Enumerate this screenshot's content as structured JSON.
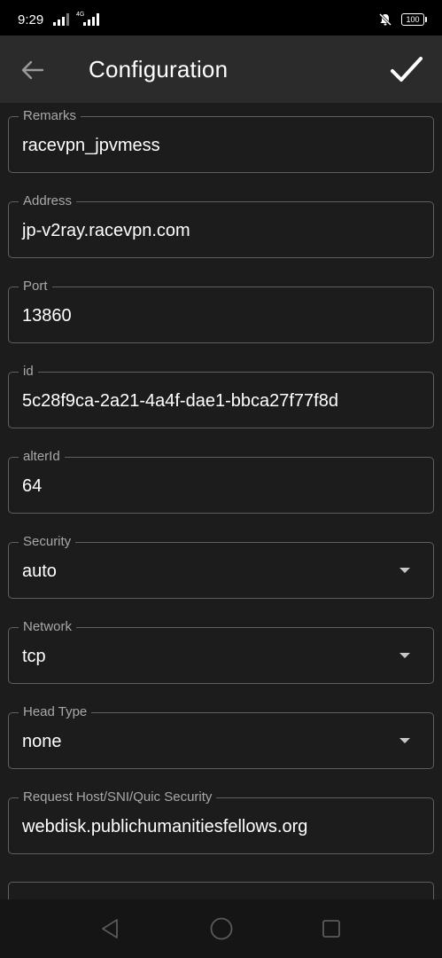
{
  "status_bar": {
    "time": "9:29",
    "net_label_top": "4G",
    "battery": "100",
    "icons": [
      "signal-icon",
      "signal-4g-icon",
      "mute-icon",
      "battery-icon"
    ]
  },
  "app_bar": {
    "title": "Configuration",
    "back_icon": "arrow-left-icon",
    "confirm_icon": "check-icon"
  },
  "form": {
    "remarks": {
      "label": "Remarks",
      "value": "racevpn_jpvmess"
    },
    "address": {
      "label": "Address",
      "value": "jp-v2ray.racevpn.com"
    },
    "port": {
      "label": "Port",
      "value": "13860"
    },
    "id": {
      "label": "id",
      "value": "5c28f9ca-2a21-4a4f-dae1-bbca27f77f8d"
    },
    "alter_id": {
      "label": "alterId",
      "value": "64"
    },
    "security": {
      "label": "Security",
      "value": "auto"
    },
    "network": {
      "label": "Network",
      "value": "tcp"
    },
    "head_type": {
      "label": "Head Type",
      "value": "none"
    },
    "request_host": {
      "label": "Request Host/SNI/Quic Security",
      "value": "webdisk.publichumanitiesfellows.org"
    }
  },
  "nav_bar": {
    "icons": [
      "nav-back-icon",
      "nav-home-icon",
      "nav-recents-icon"
    ]
  },
  "colors": {
    "background": "#1c1c1c",
    "app_bar": "#2b2b2b",
    "field_border": "#5f5f5f",
    "label": "#a8a8a8",
    "text": "#ffffff"
  }
}
